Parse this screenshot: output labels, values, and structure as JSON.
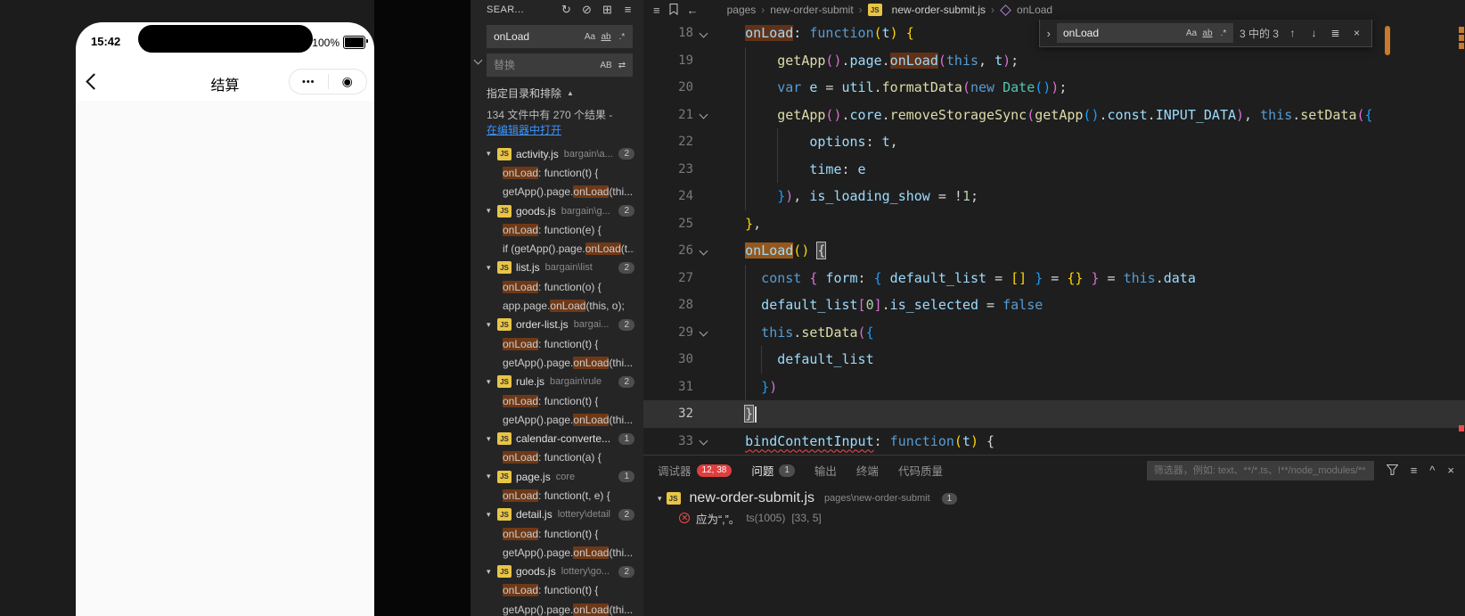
{
  "js_label": "JS",
  "colors": {
    "find_match": "#613218",
    "find_match_current": "#94581d",
    "error_red": "#f14c4c",
    "badge_red": "#e03e3e",
    "link_blue": "#3794ff",
    "js_icon_yellow": "#e8c545",
    "minimap_find_marker": "#c97a2b"
  },
  "icons": {
    "refresh": "↻",
    "clear_results": "⊘",
    "new_search_editor": "⊞",
    "views": "≡",
    "match_case": "Aa",
    "whole_word": "ab",
    "regex": ".*",
    "preserve_case": "AB",
    "replace_all": "⇄",
    "details_collapse": "▲",
    "twisty": "▾",
    "list": "≡",
    "back": "←",
    "crumb_sep": "›",
    "find_toggle": "›",
    "prev_match": "↑",
    "next_match": "↓",
    "find_selection": "≣",
    "close": "×",
    "maximize": "^",
    "capsule_menu": "•••",
    "capsule_home": "◉"
  },
  "simulator": {
    "time": "15:42",
    "battery_percent": "100%",
    "nav_title": "结算"
  },
  "search": {
    "header": "SEAR...",
    "query": "onLoad",
    "replace_placeholder": "替换",
    "details_label": "指定目录和排除",
    "summary": "134 文件中有 270 个结果 -",
    "open_in_editor": "在编辑器中打开",
    "results": [
      {
        "type": "file",
        "name": "activity.js",
        "path": "bargain\\a...",
        "badge": "2"
      },
      {
        "type": "match",
        "pre": "",
        "match": "onLoad",
        "post": ": function(t) {"
      },
      {
        "type": "match",
        "pre": "getApp().page.",
        "match": "onLoad",
        "post": "(thi..."
      },
      {
        "type": "file",
        "name": "goods.js",
        "path": "bargain\\g...",
        "badge": "2"
      },
      {
        "type": "match",
        "pre": "",
        "match": "onLoad",
        "post": ": function(e) {"
      },
      {
        "type": "match",
        "pre": "if (getApp().page.",
        "match": "onLoad",
        "post": "(t..."
      },
      {
        "type": "file",
        "name": "list.js",
        "path": "bargain\\list",
        "badge": "2"
      },
      {
        "type": "match",
        "pre": "",
        "match": "onLoad",
        "post": ": function(o) {"
      },
      {
        "type": "match",
        "pre": "app.page.",
        "match": "onLoad",
        "post": "(this, o);"
      },
      {
        "type": "file",
        "name": "order-list.js",
        "path": "bargai...",
        "badge": "2"
      },
      {
        "type": "match",
        "pre": "",
        "match": "onLoad",
        "post": ": function(t) {"
      },
      {
        "type": "match",
        "pre": "getApp().page.",
        "match": "onLoad",
        "post": "(thi..."
      },
      {
        "type": "file",
        "name": "rule.js",
        "path": "bargain\\rule",
        "badge": "2"
      },
      {
        "type": "match",
        "pre": "",
        "match": "onLoad",
        "post": ": function(t) {"
      },
      {
        "type": "match",
        "pre": "getApp().page.",
        "match": "onLoad",
        "post": "(thi..."
      },
      {
        "type": "file",
        "name": "calendar-converte...",
        "path": "",
        "badge": "1"
      },
      {
        "type": "match",
        "pre": "",
        "match": "onLoad",
        "post": ": function(a) {"
      },
      {
        "type": "file",
        "name": "page.js",
        "path": "core",
        "badge": "1"
      },
      {
        "type": "match",
        "pre": "",
        "match": "onLoad",
        "post": ": function(t, e) {"
      },
      {
        "type": "file",
        "name": "detail.js",
        "path": "lottery\\detail",
        "badge": "2"
      },
      {
        "type": "match",
        "pre": "",
        "match": "onLoad",
        "post": ": function(t) {"
      },
      {
        "type": "match",
        "pre": "getApp().page.",
        "match": "onLoad",
        "post": "(thi..."
      },
      {
        "type": "file",
        "name": "goods.js",
        "path": "lottery\\go...",
        "badge": "2"
      },
      {
        "type": "match",
        "pre": "",
        "match": "onLoad",
        "post": ": function(t) {"
      },
      {
        "type": "match",
        "pre": "getApp().page.",
        "match": "onLoad",
        "post": "(thi..."
      }
    ]
  },
  "editor": {
    "breadcrumb": {
      "seg1": "pages",
      "seg2": "new-order-submit",
      "file": "new-order-submit.js",
      "symbol": "onLoad"
    },
    "find": {
      "query": "onLoad",
      "matches": "3 中的 3"
    },
    "lines": [
      {
        "no": "18",
        "fold": true,
        "indent": 4,
        "guides": [],
        "tokens": [
          [
            "onLoad",
            "v hl"
          ],
          [
            ": ",
            "p"
          ],
          [
            "function",
            "k"
          ],
          [
            "(",
            "b1"
          ],
          [
            "t",
            "v"
          ],
          [
            ")",
            "b1"
          ],
          [
            " ",
            "p"
          ],
          [
            "{",
            "b1"
          ]
        ]
      },
      {
        "no": "19",
        "indent": 8,
        "guides": [
          4
        ],
        "tokens": [
          [
            "getApp",
            "f"
          ],
          [
            "(",
            "b2"
          ],
          [
            ")",
            "b2"
          ],
          [
            ".",
            "p"
          ],
          [
            "page",
            "v"
          ],
          [
            ".",
            "p"
          ],
          [
            "onLoad",
            "v hl"
          ],
          [
            "(",
            "b2"
          ],
          [
            "this",
            "k"
          ],
          [
            ", ",
            "p"
          ],
          [
            "t",
            "v"
          ],
          [
            ")",
            "b2"
          ],
          [
            ";",
            "p"
          ]
        ]
      },
      {
        "no": "20",
        "indent": 8,
        "guides": [
          4
        ],
        "tokens": [
          [
            "var",
            "k"
          ],
          [
            " ",
            "p"
          ],
          [
            "e",
            "v"
          ],
          [
            " = ",
            "p"
          ],
          [
            "util",
            "v"
          ],
          [
            ".",
            "p"
          ],
          [
            "formatData",
            "f"
          ],
          [
            "(",
            "b2"
          ],
          [
            "new",
            "k"
          ],
          [
            " ",
            "p"
          ],
          [
            "Date",
            "t"
          ],
          [
            "(",
            "b3"
          ],
          [
            ")",
            "b3"
          ],
          [
            ")",
            "b2"
          ],
          [
            ";",
            "p"
          ]
        ]
      },
      {
        "no": "21",
        "fold": true,
        "indent": 8,
        "guides": [
          4
        ],
        "tokens": [
          [
            "getApp",
            "f"
          ],
          [
            "(",
            "b2"
          ],
          [
            ")",
            "b2"
          ],
          [
            ".",
            "p"
          ],
          [
            "core",
            "v"
          ],
          [
            ".",
            "p"
          ],
          [
            "removeStorageSync",
            "f"
          ],
          [
            "(",
            "b2"
          ],
          [
            "getApp",
            "f"
          ],
          [
            "(",
            "b3"
          ],
          [
            ")",
            "b3"
          ],
          [
            ".",
            "p"
          ],
          [
            "const",
            "v"
          ],
          [
            ".",
            "p"
          ],
          [
            "INPUT_DATA",
            "v"
          ],
          [
            ")",
            "b2"
          ],
          [
            ", ",
            "p"
          ],
          [
            "this",
            "k"
          ],
          [
            ".",
            "p"
          ],
          [
            "setData",
            "f"
          ],
          [
            "(",
            "b2"
          ],
          [
            "{",
            "b3"
          ]
        ]
      },
      {
        "no": "22",
        "indent": 12,
        "guides": [
          4,
          8
        ],
        "tokens": [
          [
            "options",
            "v"
          ],
          [
            ": ",
            "p"
          ],
          [
            "t",
            "v"
          ],
          [
            ",",
            "p"
          ]
        ]
      },
      {
        "no": "23",
        "indent": 12,
        "guides": [
          4,
          8
        ],
        "tokens": [
          [
            "time",
            "v"
          ],
          [
            ": ",
            "p"
          ],
          [
            "e",
            "v"
          ]
        ]
      },
      {
        "no": "24",
        "indent": 8,
        "guides": [
          4
        ],
        "tokens": [
          [
            "}",
            "b3"
          ],
          [
            ")",
            "b2"
          ],
          [
            ", ",
            "p"
          ],
          [
            "is_loading_show",
            "v"
          ],
          [
            " = ",
            "p"
          ],
          [
            "!",
            "p"
          ],
          [
            "1",
            "n"
          ],
          [
            ";",
            "p"
          ]
        ]
      },
      {
        "no": "25",
        "indent": 4,
        "guides": [],
        "tokens": [
          [
            "}",
            "b1"
          ],
          [
            ",",
            "p"
          ]
        ]
      },
      {
        "no": "26",
        "fold": true,
        "indent": 4,
        "guides": [],
        "tokens": [
          [
            "onLoad",
            "v cur"
          ],
          [
            "(",
            "b1"
          ],
          [
            ")",
            "b1"
          ],
          [
            " ",
            "p"
          ],
          [
            "{",
            "box"
          ]
        ]
      },
      {
        "no": "27",
        "indent": 6,
        "guides": [
          4
        ],
        "tokens": [
          [
            "const",
            "k"
          ],
          [
            " ",
            "p"
          ],
          [
            "{",
            "b2"
          ],
          [
            " ",
            "p"
          ],
          [
            "form",
            "v"
          ],
          [
            ": ",
            "p"
          ],
          [
            "{",
            "b3"
          ],
          [
            " ",
            "p"
          ],
          [
            "default_list",
            "v"
          ],
          [
            " = ",
            "p"
          ],
          [
            "[]",
            "b1"
          ],
          [
            " ",
            "p"
          ],
          [
            "}",
            "b3"
          ],
          [
            " = ",
            "p"
          ],
          [
            "{}",
            "b1"
          ],
          [
            " ",
            "p"
          ],
          [
            "}",
            "b2"
          ],
          [
            " = ",
            "p"
          ],
          [
            "this",
            "k"
          ],
          [
            ".",
            "p"
          ],
          [
            "data",
            "v"
          ]
        ]
      },
      {
        "no": "28",
        "indent": 6,
        "guides": [
          4
        ],
        "tokens": [
          [
            "default_list",
            "v"
          ],
          [
            "[",
            "b2"
          ],
          [
            "0",
            "n"
          ],
          [
            "]",
            "b2"
          ],
          [
            ".",
            "p"
          ],
          [
            "is_selected",
            "v"
          ],
          [
            " = ",
            "p"
          ],
          [
            "false",
            "k"
          ]
        ]
      },
      {
        "no": "29",
        "fold": true,
        "indent": 6,
        "guides": [
          4
        ],
        "tokens": [
          [
            "this",
            "k"
          ],
          [
            ".",
            "p"
          ],
          [
            "setData",
            "f"
          ],
          [
            "(",
            "b2"
          ],
          [
            "{",
            "b3"
          ]
        ]
      },
      {
        "no": "30",
        "indent": 8,
        "guides": [
          4,
          6
        ],
        "tokens": [
          [
            "default_list",
            "v"
          ]
        ]
      },
      {
        "no": "31",
        "indent": 6,
        "guides": [
          4
        ],
        "tokens": [
          [
            "}",
            "b3"
          ],
          [
            ")",
            "b2"
          ]
        ]
      },
      {
        "no": "32",
        "indent": 4,
        "guides": [],
        "current": true,
        "cursor": true,
        "tokens": [
          [
            "}",
            "box"
          ]
        ]
      },
      {
        "no": "33",
        "fold": true,
        "indent": 4,
        "guides": [],
        "tokens": [
          [
            "bindContentInput",
            "v err"
          ],
          [
            ": ",
            "p"
          ],
          [
            "function",
            "k"
          ],
          [
            "(",
            "b1"
          ],
          [
            "t",
            "v"
          ],
          [
            ")",
            "b1"
          ],
          [
            " ",
            "p"
          ],
          [
            "{",
            "p"
          ]
        ]
      }
    ]
  },
  "panel": {
    "tabs": [
      {
        "label": "调试器",
        "name": "debugger",
        "badge": "12, 38",
        "badge_style": "red"
      },
      {
        "label": "问题",
        "name": "problems",
        "badge": "1",
        "badge_style": "gray",
        "active": true
      },
      {
        "label": "输出",
        "name": "output"
      },
      {
        "label": "终端",
        "name": "terminal"
      },
      {
        "label": "代码质量",
        "name": "code-quality"
      }
    ],
    "filter_placeholder": "筛选器，例如: text、**/*.ts、!**/node_modules/**",
    "problems": {
      "file": "new-order-submit.js",
      "path": "pages\\new-order-submit",
      "badge": "1",
      "items": [
        {
          "message": "应为“,”。",
          "source": "ts(1005)",
          "position": "[33, 5]"
        }
      ]
    }
  }
}
